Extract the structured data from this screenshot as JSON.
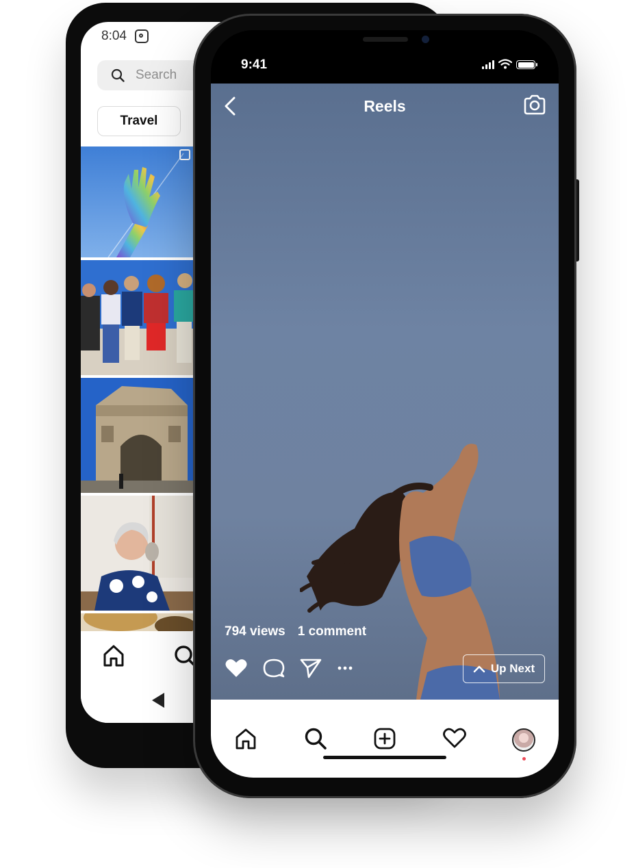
{
  "back_phone": {
    "status_time": "8:04",
    "search_placeholder": "Search",
    "category_chip": "Travel"
  },
  "front_phone": {
    "status_time": "9:41",
    "header_title": "Reels",
    "views": "794 views",
    "comments": "1 comment",
    "up_next_label": "Up Next"
  },
  "colors": {
    "accent_notification": "#ed4956",
    "video_sky": "#6e83a3"
  }
}
